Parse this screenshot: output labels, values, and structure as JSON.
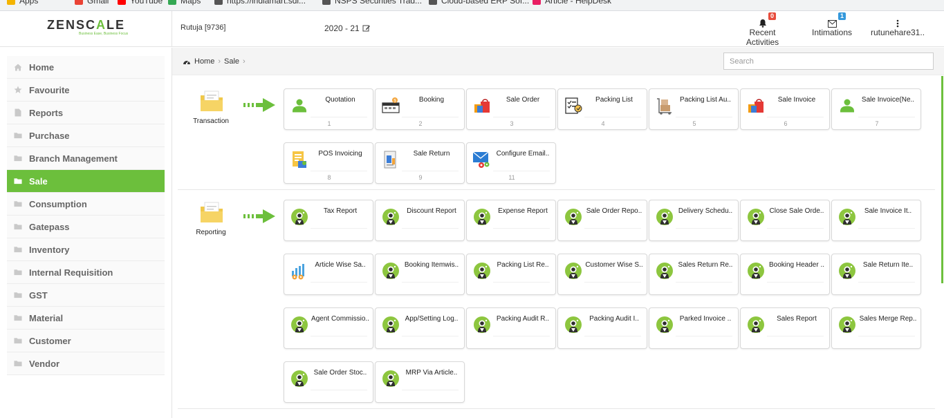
{
  "bookmarks": [
    {
      "label": "Apps",
      "color": "#f4b400"
    },
    {
      "label": "Gmail",
      "color": "#ea4335"
    },
    {
      "label": "YouTube",
      "color": "#ff0000"
    },
    {
      "label": "Maps",
      "color": "#34a853"
    },
    {
      "label": "https://indiamart.sdi...",
      "color": "#555555"
    },
    {
      "label": "NSPS Securities Trad...",
      "color": "#555555"
    },
    {
      "label": "Cloud-based ERP Sof...",
      "color": "#555555"
    },
    {
      "label": "Article - HelpDesk",
      "color": "#e91e63"
    }
  ],
  "header": {
    "logo_main": "ZENSC",
    "logo_accent": "A",
    "logo_tail": "LE",
    "tagline": "Business Ease, Business Focus",
    "user": "Rutuja [9736]",
    "financial_year": "2020 - 21",
    "recent_activities": {
      "label": "Recent Activities",
      "count": "0",
      "badge_color": "#e74c3c"
    },
    "intimations": {
      "label": "Intimations",
      "count": "1",
      "badge_color": "#3498db"
    },
    "account": {
      "label": "rutunehare31.."
    }
  },
  "sidebar": {
    "items": [
      {
        "label": "Home",
        "icon": "home-icon"
      },
      {
        "label": "Favourite",
        "icon": "star-icon"
      },
      {
        "label": "Reports",
        "icon": "file-icon"
      },
      {
        "label": "Purchase",
        "icon": "folder-icon"
      },
      {
        "label": "Branch Management",
        "icon": "folder-icon"
      },
      {
        "label": "Sale",
        "icon": "folder-icon",
        "active": true
      },
      {
        "label": "Consumption",
        "icon": "folder-icon"
      },
      {
        "label": "Gatepass",
        "icon": "folder-icon"
      },
      {
        "label": "Inventory",
        "icon": "folder-icon"
      },
      {
        "label": "Internal Requisition",
        "icon": "folder-icon"
      },
      {
        "label": "GST",
        "icon": "folder-icon"
      },
      {
        "label": "Material",
        "icon": "folder-icon"
      },
      {
        "label": "Customer",
        "icon": "folder-icon"
      },
      {
        "label": "Vendor",
        "icon": "folder-icon"
      }
    ],
    "accent": "#6cbf3c"
  },
  "breadcrumb": {
    "home": "Home",
    "current": "Sale"
  },
  "search": {
    "placeholder": "Search"
  },
  "groups": [
    {
      "label": "Transaction",
      "tiles": [
        {
          "label": "Quotation",
          "num": "1",
          "icon": "user-icon"
        },
        {
          "label": "Booking",
          "num": "2",
          "icon": "booking-icon"
        },
        {
          "label": "Sale Order",
          "num": "3",
          "icon": "shopping-bag-icon"
        },
        {
          "label": "Packing List",
          "num": "4",
          "icon": "checklist-icon"
        },
        {
          "label": "Packing List Au..",
          "num": "5",
          "icon": "boxes-trolley-icon"
        },
        {
          "label": "Sale Invoice",
          "num": "6",
          "icon": "shopping-bag-icon"
        },
        {
          "label": "Sale Invoice(Ne..",
          "num": "7",
          "icon": "user-icon"
        },
        {
          "label": "POS Invoicing",
          "num": "8",
          "icon": "pos-icon"
        },
        {
          "label": "Sale Return",
          "num": "9",
          "icon": "return-doc-icon"
        },
        {
          "label": "Configure Email..",
          "num": "11",
          "icon": "email-gear-icon"
        }
      ]
    },
    {
      "label": "Reporting",
      "tiles": [
        {
          "label": "Tax Report",
          "icon": "report-person-icon"
        },
        {
          "label": "Discount Report",
          "icon": "report-person-icon"
        },
        {
          "label": "Expense Report",
          "icon": "report-person-icon"
        },
        {
          "label": "Sale Order Repo..",
          "icon": "report-person-icon"
        },
        {
          "label": "Delivery Schedu..",
          "icon": "report-person-icon"
        },
        {
          "label": "Close Sale Orde..",
          "icon": "report-person-icon"
        },
        {
          "label": "Sale Invoice It..",
          "icon": "report-person-icon"
        },
        {
          "label": "Article Wise Sa..",
          "icon": "chart-gear-icon"
        },
        {
          "label": "Booking Itemwis..",
          "icon": "report-person-icon"
        },
        {
          "label": "Packing List Re..",
          "icon": "report-person-icon"
        },
        {
          "label": "Customer Wise S..",
          "icon": "report-person-icon"
        },
        {
          "label": "Sales Return Re..",
          "icon": "report-person-icon"
        },
        {
          "label": "Booking Header ..",
          "icon": "report-person-icon"
        },
        {
          "label": "Sale Return Ite..",
          "icon": "report-person-icon"
        },
        {
          "label": "Agent Commissio..",
          "icon": "report-person-icon"
        },
        {
          "label": "App/Setting Log..",
          "icon": "report-person-icon"
        },
        {
          "label": "Packing Audit R..",
          "icon": "report-person-icon"
        },
        {
          "label": "Packing Audit I..",
          "icon": "report-person-icon"
        },
        {
          "label": "Parked Invoice ..",
          "icon": "report-person-icon"
        },
        {
          "label": "Sales Report",
          "icon": "report-person-icon"
        },
        {
          "label": "Sales Merge Rep..",
          "icon": "report-person-icon"
        },
        {
          "label": "Sale Order Stoc..",
          "icon": "report-person-icon"
        },
        {
          "label": "MRP Via Article..",
          "icon": "report-person-icon"
        }
      ]
    }
  ]
}
